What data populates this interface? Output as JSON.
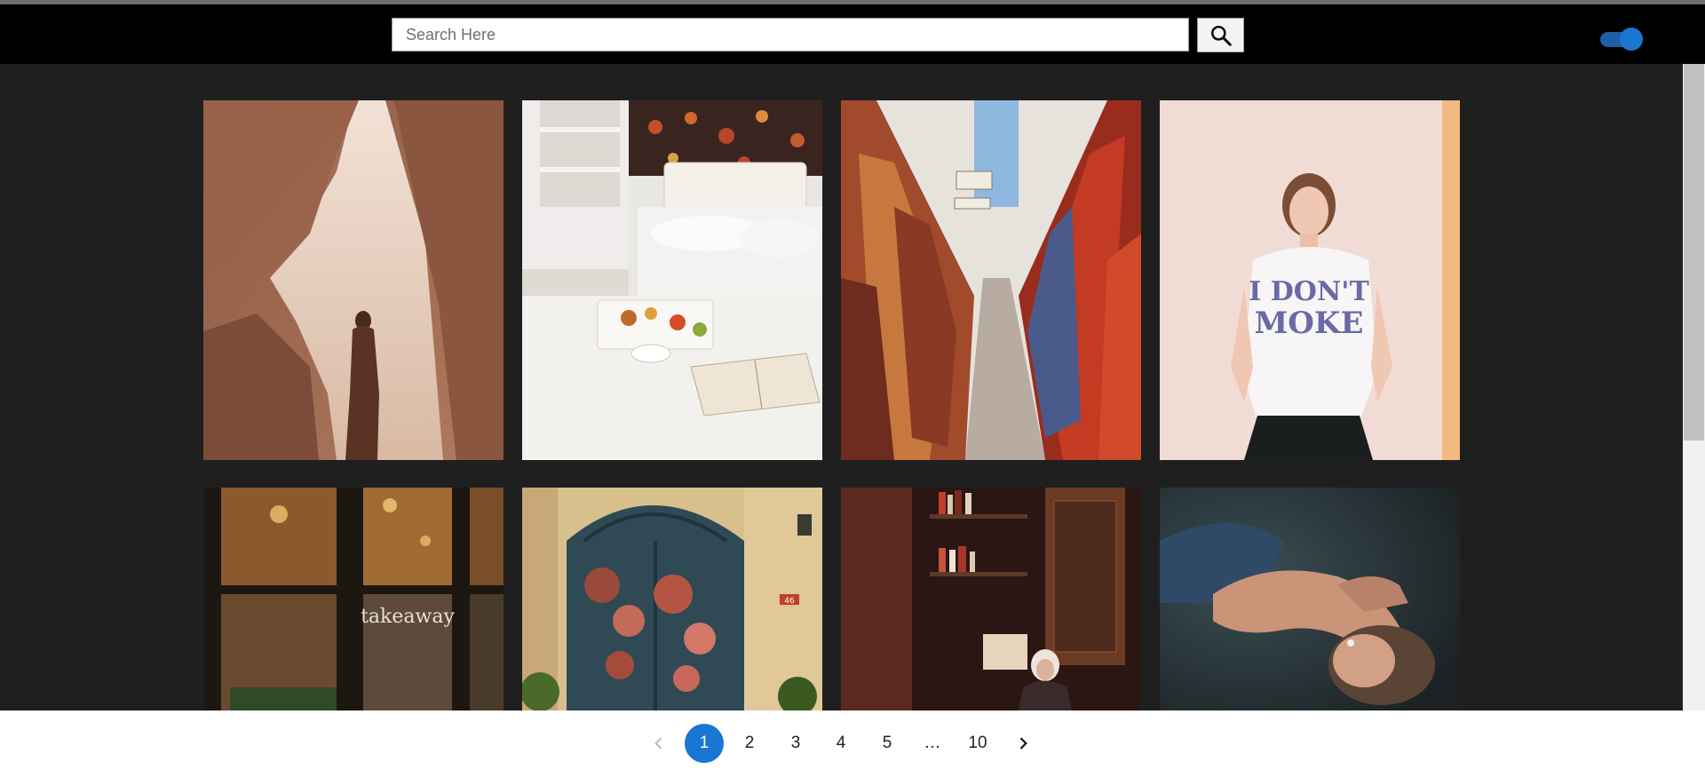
{
  "header": {
    "search": {
      "placeholder": "Search Here",
      "value": ""
    },
    "search_button_icon": "search-icon",
    "theme_toggle": {
      "state": "on",
      "icon": "toggle-switch"
    }
  },
  "gallery": {
    "photos": [
      {
        "name": "woman-in-canyon-cave-photo",
        "dominant_color": "#a8745a"
      },
      {
        "name": "breakfast-in-bed-photo",
        "dominant_color": "#e8e6e2"
      },
      {
        "name": "rug-market-alley-photo",
        "dominant_color": "#b8653e"
      },
      {
        "name": "woman-in-dont-smoke-tshirt-photo",
        "dominant_color": "#eedad3"
      },
      {
        "name": "takeaway-cafe-window-photo",
        "dominant_color": "#3a2a1c"
      },
      {
        "name": "flowered-blue-door-photo",
        "dominant_color": "#2f4a55"
      },
      {
        "name": "woman-reading-in-library-photo",
        "dominant_color": "#3a1c16"
      },
      {
        "name": "woman-lying-down-photo",
        "dominant_color": "#2e3b3d"
      }
    ],
    "window_text": "takeaway",
    "tshirt_text_line1": "I DON'T",
    "tshirt_text_line2": "MOKE",
    "door_number": "46"
  },
  "pagination": {
    "prev_icon": "chevron-left-icon",
    "next_icon": "chevron-right-icon",
    "pages": [
      "1",
      "2",
      "3",
      "4",
      "5",
      "…",
      "10"
    ],
    "current": "1"
  },
  "colors": {
    "accent": "#1976d2",
    "header_bg": "#000000",
    "page_bg": "#1f1f1f",
    "footer_bg": "#ffffff"
  }
}
